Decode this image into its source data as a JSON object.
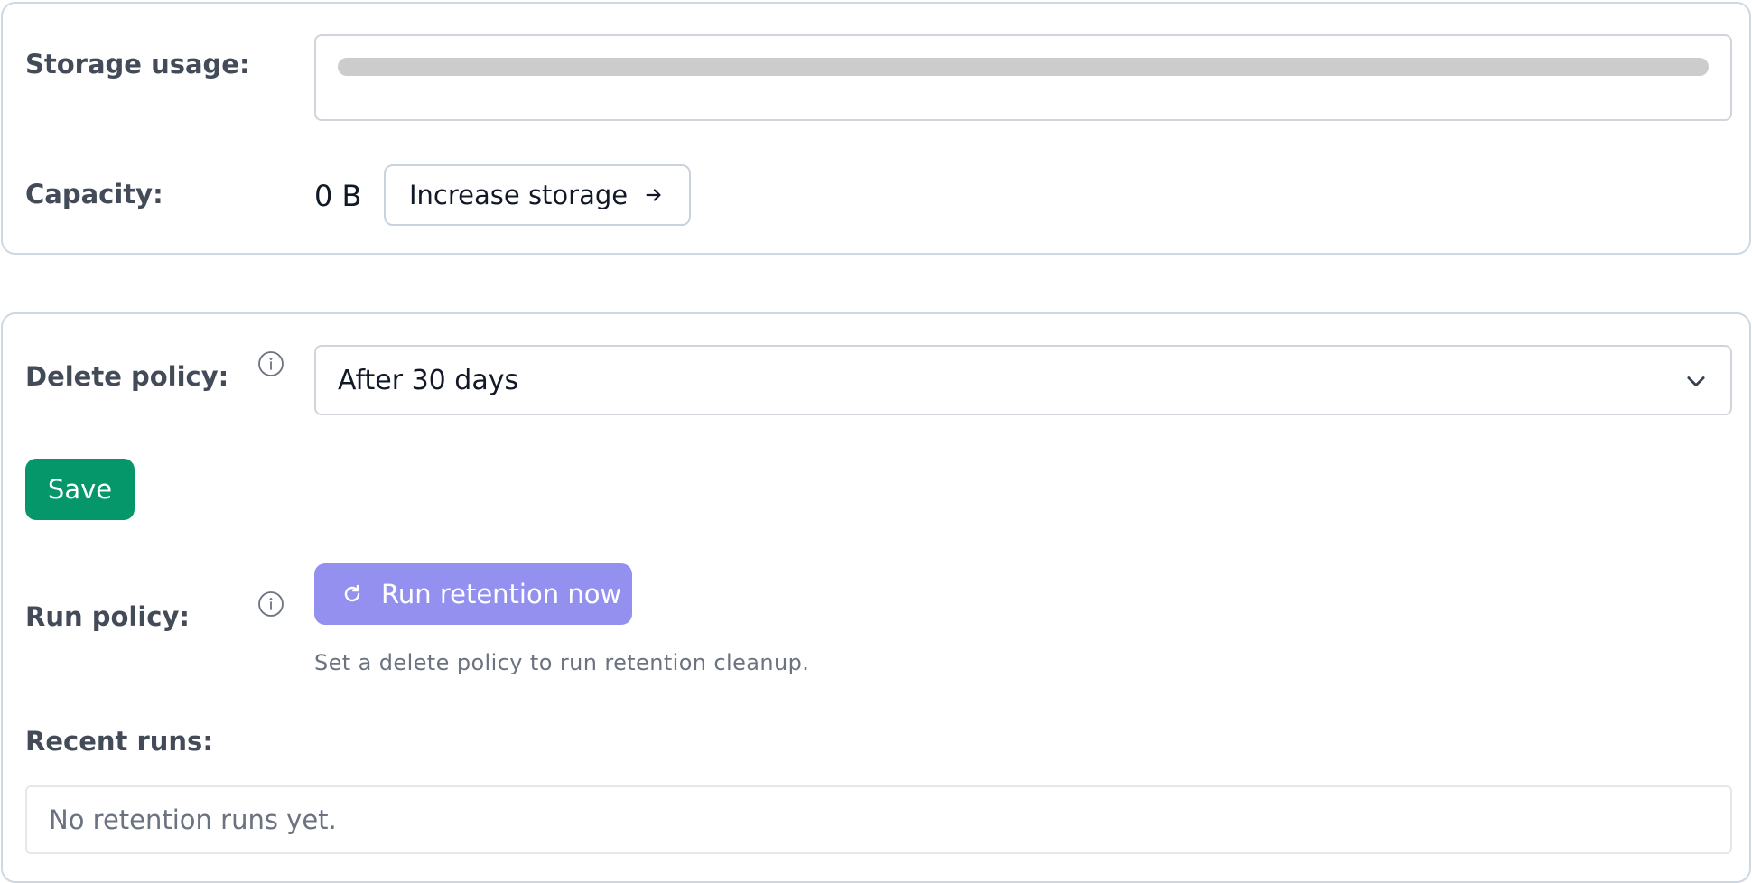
{
  "storage": {
    "usage_label": "Storage usage:",
    "usage_fraction": 0,
    "capacity_label": "Capacity:",
    "capacity_value": "0 B",
    "increase_button": "Increase storage",
    "increase_icon": "arrow-right-icon"
  },
  "retention": {
    "delete_policy_label": "Delete policy:",
    "delete_policy_value": "After 30 days",
    "save_button": "Save",
    "run_policy_label": "Run policy:",
    "run_button": "Run retention now",
    "run_icon": "refresh-icon",
    "run_hint": "Set a delete policy to run retention cleanup.",
    "recent_runs_label": "Recent runs:",
    "recent_runs_empty": "No retention runs yet."
  },
  "colors": {
    "save_green": "#059669",
    "run_purple_disabled": "#9490ef",
    "card_border": "#cdd8e1",
    "label_text": "#424b57",
    "track_gray": "#cccccc"
  }
}
